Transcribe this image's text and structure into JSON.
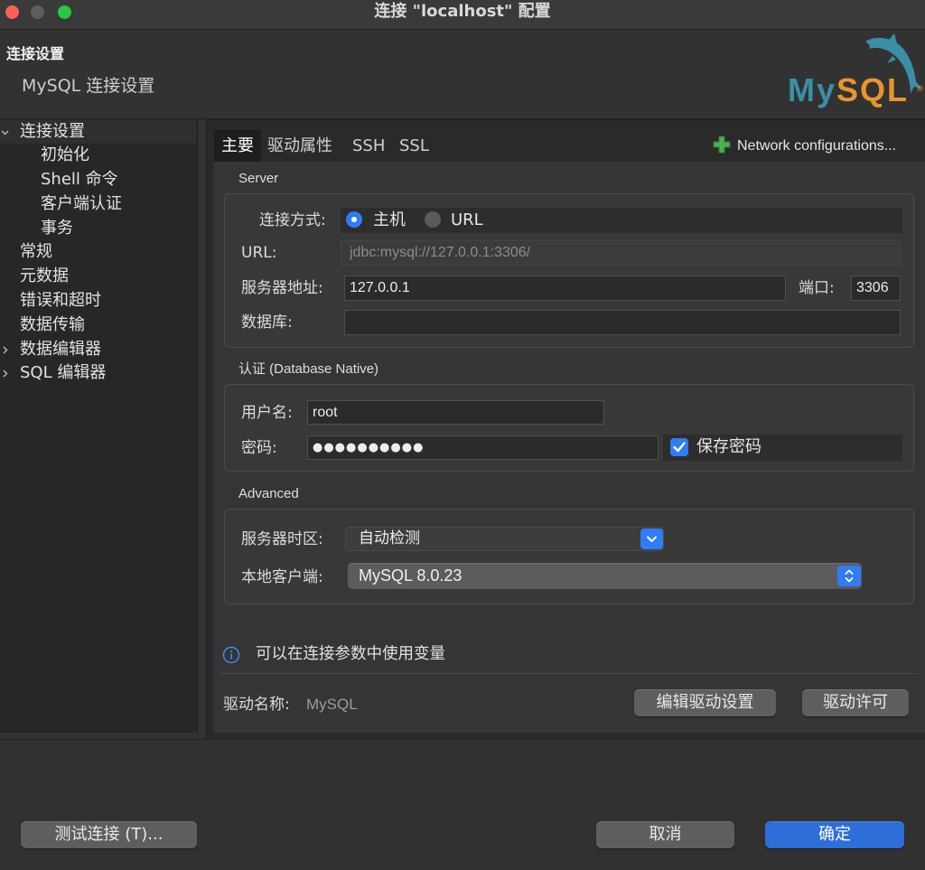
{
  "window": {
    "title": "连接 \"localhost\" 配置"
  },
  "header": {
    "title": "连接设置",
    "subtitle": "MySQL 连接设置",
    "logo": {
      "my": "My",
      "sql": "SQL",
      "registered": "®",
      "icon": "mysql-dolphin-logo"
    }
  },
  "sidebar": {
    "items": [
      {
        "label": "连接设置",
        "expandable": true,
        "expanded": true,
        "selected": true,
        "children": [
          {
            "label": "初始化"
          },
          {
            "label": "Shell 命令"
          },
          {
            "label": "客户端认证"
          },
          {
            "label": "事务"
          }
        ]
      },
      {
        "label": "常规"
      },
      {
        "label": "元数据"
      },
      {
        "label": "错误和超时"
      },
      {
        "label": "数据传输"
      },
      {
        "label": "数据编辑器",
        "expandable": true,
        "expanded": false
      },
      {
        "label": "SQL 编辑器",
        "expandable": true,
        "expanded": false
      }
    ]
  },
  "tabs": [
    {
      "label": "主要",
      "selected": true
    },
    {
      "label": "驱动属性",
      "selected": false
    },
    {
      "label": "SSH",
      "selected": false
    },
    {
      "label": "SSL",
      "selected": false
    }
  ],
  "network_config": {
    "label": "Network configurations...",
    "icon": "plus-icon"
  },
  "server": {
    "section_title": "Server",
    "connect_by": {
      "label": "连接方式:",
      "options": [
        {
          "label": "主机",
          "checked": true
        },
        {
          "label": "URL",
          "checked": false
        }
      ]
    },
    "url": {
      "label": "URL:",
      "value": "jdbc:mysql://127.0.0.1:3306/",
      "enabled": false
    },
    "host": {
      "label": "服务器地址:",
      "value": "127.0.0.1"
    },
    "port": {
      "label": "端口:",
      "value": "3306"
    },
    "database": {
      "label": "数据库:",
      "value": ""
    }
  },
  "auth": {
    "section_title": "认证 (Database Native)",
    "username": {
      "label": "用户名:",
      "value": "root"
    },
    "password": {
      "label": "密码:",
      "value": "●●●●●●●●●●"
    },
    "save_password": {
      "label": "保存密码",
      "checked": true
    }
  },
  "advanced": {
    "section_title": "Advanced",
    "server_timezone": {
      "label": "服务器时区:",
      "value": "自动检测",
      "icon": "chevron-down-icon"
    },
    "local_client": {
      "label": "本地客户端:",
      "value": "MySQL 8.0.23",
      "icon": "up-down-chevron-icon"
    }
  },
  "info": {
    "icon": "info-icon",
    "text": "可以在连接参数中使用变量"
  },
  "driver": {
    "label": "驱动名称:",
    "name": "MySQL",
    "edit_button": "编辑驱动设置",
    "license_button": "驱动许可"
  },
  "footer": {
    "test_button": "测试连接 (T)...",
    "cancel_button": "取消",
    "ok_button": "确定"
  },
  "colors": {
    "accent": "#2f7cf6",
    "primary": "#2e6ed9",
    "close": "#ff5f57",
    "minimize": "#5d5d5d",
    "zoom": "#28c840",
    "logo-teal": "#3a8ea5",
    "logo-orange": "#e8952c",
    "info": "#3d8ef0",
    "plus": "#4caf50"
  }
}
